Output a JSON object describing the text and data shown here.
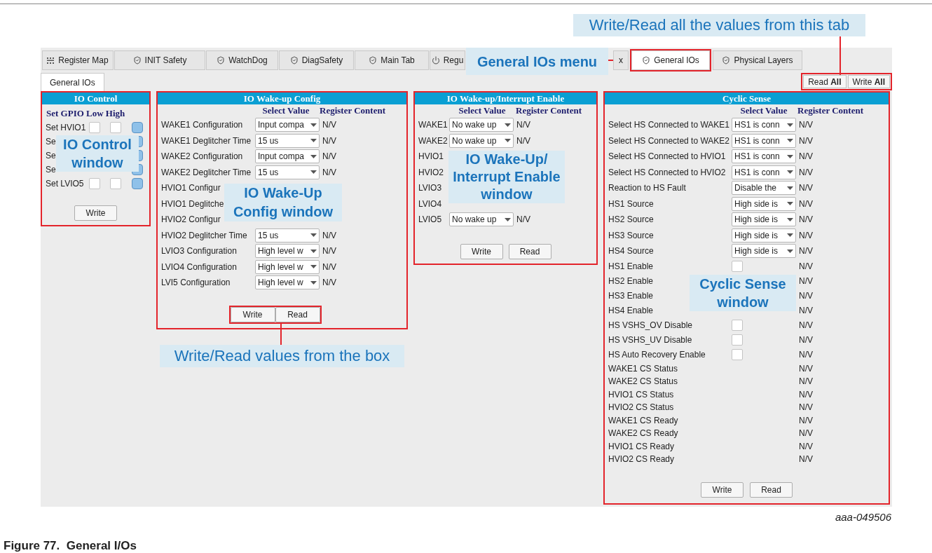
{
  "tabs": [
    {
      "label": "Register Map",
      "kind": "map",
      "selected": false
    },
    {
      "label": "INIT Safety",
      "kind": "shield",
      "selected": false
    },
    {
      "label": "WatchDog",
      "kind": "shield",
      "selected": false
    },
    {
      "label": "DiagSafety",
      "kind": "shield",
      "selected": false
    },
    {
      "label": "Main Tab",
      "kind": "shield",
      "selected": false
    },
    {
      "label": "Regu",
      "kind": "power",
      "selected": false
    },
    {
      "label": "x",
      "kind": "none",
      "selected": false
    },
    {
      "label": "General IOs",
      "kind": "shield",
      "selected": true
    },
    {
      "label": "Physical Layers",
      "kind": "shield",
      "selected": false
    }
  ],
  "subtabs": [
    {
      "label": "General IOs",
      "selected": true
    }
  ],
  "global_buttons": [
    "Read **All**",
    "Write **All**"
  ],
  "io_control": {
    "title": "IO Control",
    "header": "Set GPIO Low High",
    "rows": [
      {
        "label": "Set HVIO1",
        "low": false,
        "high": false
      },
      {
        "label": "Se"
      },
      {
        "label": "Se"
      },
      {
        "label": "Se"
      },
      {
        "label": "Set LVIO5",
        "low": false,
        "high": false
      }
    ],
    "buttons": [
      "Write"
    ]
  },
  "wakeup_config": {
    "title": "IO Wake-up Config",
    "columns": [
      "Select Value",
      "Register Content"
    ],
    "rows": [
      {
        "label": "WAKE1 Configuration",
        "value": "Input compa",
        "register": "N/V"
      },
      {
        "label": "WAKE1 Deglitcher Time",
        "value": "15 us",
        "register": "N/V"
      },
      {
        "label": "WAKE2 Configuration",
        "value": "Input compa",
        "register": "N/V"
      },
      {
        "label": "WAKE2 Deglitcher Time",
        "value": "15 us",
        "register": "N/V"
      },
      {
        "label": "HVIO1 Configur"
      },
      {
        "label": "HVIO1 Deglitche"
      },
      {
        "label": "HVIO2 Configur"
      },
      {
        "label": "HVIO2 Deglitcher Time",
        "value": "15 us",
        "register": "N/V"
      },
      {
        "label": "LVIO3 Configuration",
        "value": "High level w",
        "register": "N/V"
      },
      {
        "label": "LVIO4 Configuration",
        "value": "High level w",
        "register": "N/V"
      },
      {
        "label": "LVI5 Configuration",
        "value": "High level w",
        "register": "N/V"
      }
    ],
    "buttons": [
      "Write",
      "Read"
    ]
  },
  "interrupt_enable": {
    "title": "IO Wake-up/Interrupt Enable",
    "columns": [
      "Select Value",
      "Register Content"
    ],
    "rows": [
      {
        "label": "WAKE1",
        "value": "No wake up",
        "register": "N/V"
      },
      {
        "label": "WAKE2",
        "value": "No wake up",
        "register": "N/V"
      },
      {
        "label": "HVIO1"
      },
      {
        "label": "HVIO2"
      },
      {
        "label": "LVIO3"
      },
      {
        "label": "LVIO4"
      },
      {
        "label": "LVIO5",
        "value": "No wake up",
        "register": "N/V"
      }
    ],
    "buttons": [
      "Write",
      "Read"
    ]
  },
  "cyclic_sense": {
    "title": "Cyclic Sense",
    "columns": [
      "Select Value",
      "Register Content"
    ],
    "rows": [
      {
        "kind": "select",
        "label": "Select HS Connected to WAKE1",
        "value": "HS1 is conn",
        "register": "N/V"
      },
      {
        "kind": "select",
        "label": "Select HS Connected to WAKE2",
        "value": "HS1 is conn",
        "register": "N/V"
      },
      {
        "kind": "select",
        "label": "Select HS Connected to HVIO1",
        "value": "HS1 is conn",
        "register": "N/V"
      },
      {
        "kind": "select",
        "label": "Select HS Connected to HVIO2",
        "value": "HS1 is conn",
        "register": "N/V"
      },
      {
        "kind": "select",
        "label": "Reaction to HS Fault",
        "value": "Disable the",
        "register": "N/V"
      },
      {
        "kind": "select",
        "label": "HS1 Source",
        "value": "High side is",
        "register": "N/V"
      },
      {
        "kind": "select",
        "label": "HS2 Source",
        "value": "High side is",
        "register": "N/V"
      },
      {
        "kind": "select",
        "label": "HS3 Source",
        "value": "High side is",
        "register": "N/V"
      },
      {
        "kind": "select",
        "label": "HS4 Source",
        "value": "High side is",
        "register": "N/V"
      },
      {
        "kind": "check",
        "label": "HS1 Enable",
        "checked": false,
        "register": "N/V"
      },
      {
        "kind": "label",
        "label": "HS2 Enable",
        "register": "N/V"
      },
      {
        "kind": "label",
        "label": "HS3 Enable",
        "register": "N/V"
      },
      {
        "kind": "label",
        "label": "HS4 Enable",
        "register": "N/V"
      },
      {
        "kind": "check",
        "label": "HS VSHS_OV Disable",
        "checked": false,
        "register": "N/V"
      },
      {
        "kind": "check",
        "label": "HS VSHS_UV Disable",
        "checked": false,
        "register": "N/V"
      },
      {
        "kind": "check",
        "label": "HS Auto Recovery Enable",
        "checked": false,
        "register": "N/V"
      },
      {
        "kind": "status",
        "label": "WAKE1 CS Status",
        "register": "N/V"
      },
      {
        "kind": "status",
        "label": "WAKE2 CS Status",
        "register": "N/V"
      },
      {
        "kind": "status",
        "label": "HVIO1 CS Status",
        "register": "N/V"
      },
      {
        "kind": "status",
        "label": "HVIO2 CS Status",
        "register": "N/V"
      },
      {
        "kind": "status",
        "label": "WAKE1 CS Ready",
        "register": "N/V"
      },
      {
        "kind": "status",
        "label": "WAKE2 CS Ready",
        "register": "N/V"
      },
      {
        "kind": "status",
        "label": "HVIO1 CS Ready",
        "register": "N/V"
      },
      {
        "kind": "status",
        "label": "HVIO2 CS Ready",
        "register": "N/V"
      }
    ],
    "buttons": [
      "Write",
      "Read"
    ]
  },
  "annotations": [
    {
      "text": "Write/Read all the values from this tab",
      "bold": false
    },
    {
      "text": "General IOs menu",
      "bold": true
    },
    {
      "text": "IO Control window",
      "bold": true
    },
    {
      "text": "IO Wake-Up Config window",
      "bold": true
    },
    {
      "text": "IO Wake-Up/ Interrupt Enable window",
      "bold": true
    },
    {
      "text": "Cyclic Sense window",
      "bold": true
    },
    {
      "text": "Write/Read values from the box",
      "bold": false
    }
  ],
  "figure_id": "aaa-049506",
  "caption": "Figure 77.  General I/Os"
}
